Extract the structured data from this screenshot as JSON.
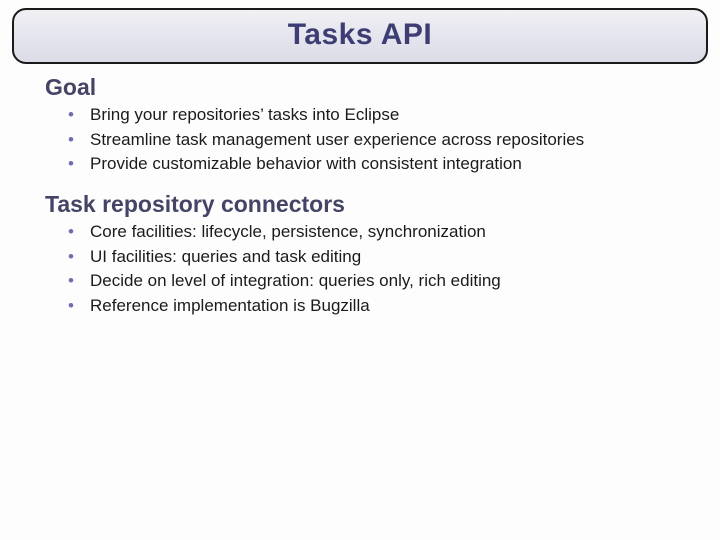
{
  "title": "Tasks API",
  "sections": [
    {
      "heading": "Goal",
      "items": [
        "Bring your repositories’ tasks into Eclipse",
        "Streamline task management user experience across repositories",
        "Provide customizable behavior with consistent integration"
      ]
    },
    {
      "heading": "Task repository connectors",
      "items": [
        "Core facilities: lifecycle, persistence, synchronization",
        "UI facilities: queries and task editing",
        "Decide on level of integration: queries only, rich editing",
        "Reference implementation is Bugzilla"
      ]
    }
  ]
}
